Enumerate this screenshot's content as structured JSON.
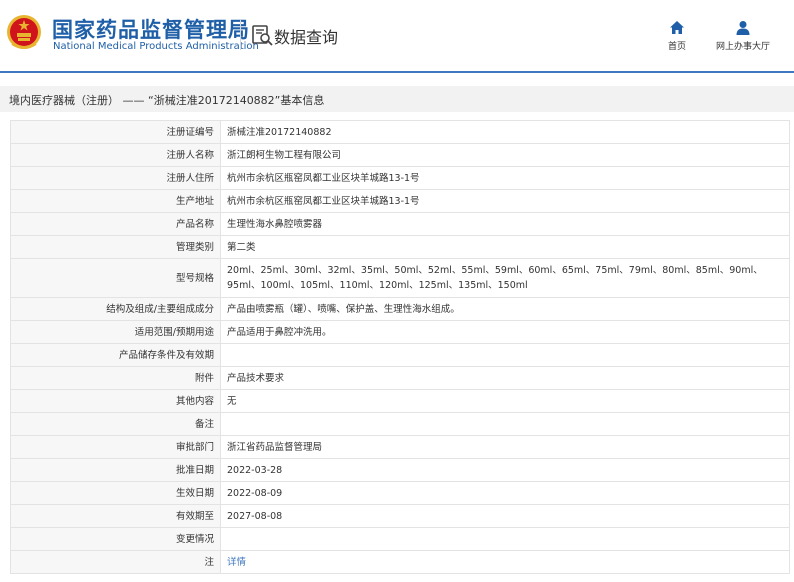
{
  "header": {
    "site_name_cn": "国家药品监督管理局",
    "site_name_en": "National Medical Products Administration",
    "query_title": "数据查询",
    "nav": [
      {
        "label": "首页",
        "icon": "home-icon"
      },
      {
        "label": "网上办事大厅",
        "icon": "user-icon"
      }
    ]
  },
  "breadcrumb": {
    "category": "境内医疗器械（注册）",
    "separator": "——",
    "record_title": "“浙械注准20172140882”基本信息"
  },
  "colors": {
    "brand_blue": "#1f5fa8",
    "header_line": "#3f77c0",
    "label_bg": "#f7f7f7",
    "link": "#3f77c0",
    "emblem_red": "#d0141c",
    "emblem_gold": "#e8b531"
  },
  "record": {
    "rows": [
      {
        "label": "注册证编号",
        "value": "浙械注准20172140882"
      },
      {
        "label": "注册人名称",
        "value": "浙江朗柯生物工程有限公司"
      },
      {
        "label": "注册人住所",
        "value": "杭州市余杭区瓶窑凤都工业区块羊城路13-1号"
      },
      {
        "label": "生产地址",
        "value": "杭州市余杭区瓶窑凤都工业区块羊城路13-1号"
      },
      {
        "label": "产品名称",
        "value": "生理性海水鼻腔喷雾器"
      },
      {
        "label": "管理类别",
        "value": "第二类"
      },
      {
        "label": "型号规格",
        "value": "20ml、25ml、30ml、32ml、35ml、50ml、52ml、55ml、59ml、60ml、65ml、75ml、79ml、80ml、85ml、90ml、95ml、100ml、105ml、110ml、120ml、125ml、135ml、150ml"
      },
      {
        "label": "结构及组成/主要组成成分",
        "value": "产品由喷雾瓶（罐）、喷嘴、保护盖、生理性海水组成。"
      },
      {
        "label": "适用范围/预期用途",
        "value": "产品适用于鼻腔冲洗用。"
      },
      {
        "label": "产品储存条件及有效期",
        "value": ""
      },
      {
        "label": "附件",
        "value": "产品技术要求"
      },
      {
        "label": "其他内容",
        "value": "无"
      },
      {
        "label": "备注",
        "value": ""
      },
      {
        "label": "审批部门",
        "value": "浙江省药品监督管理局"
      },
      {
        "label": "批准日期",
        "value": "2022-03-28"
      },
      {
        "label": "生效日期",
        "value": "2022-08-09"
      },
      {
        "label": "有效期至",
        "value": "2027-08-08"
      },
      {
        "label": "变更情况",
        "value": ""
      },
      {
        "label": "注",
        "value": "详情"
      }
    ]
  }
}
